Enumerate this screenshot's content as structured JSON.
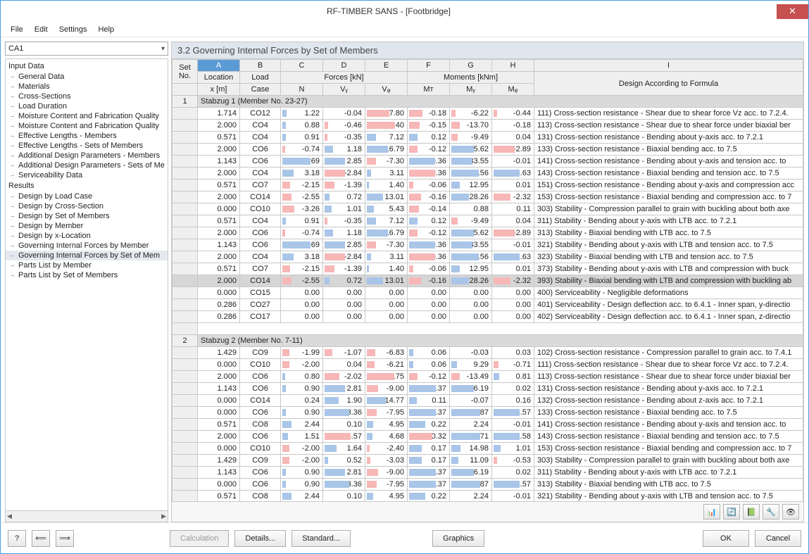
{
  "window": {
    "title": "RF-TIMBER SANS - [Footbridge]"
  },
  "menu": [
    "File",
    "Edit",
    "Settings",
    "Help"
  ],
  "sidebar": {
    "combo": "CA1",
    "groups": [
      {
        "title": "Input Data",
        "items": [
          "General Data",
          "Materials",
          "Cross-Sections",
          "Load Duration",
          "Moisture Content and Fabrication Quality",
          "Moisture Content and Fabrication Quality",
          "Effective Lengths - Members",
          "Effective Lengths - Sets of Members",
          "Additional Design Parameters - Members",
          "Additional Design Parameters - Sets of Me",
          "Serviceability Data"
        ]
      },
      {
        "title": "Results",
        "items": [
          "Design by Load Case",
          "Design by Cross-Section",
          "Design by Set of Members",
          "Design by Member",
          "Design by x-Location",
          "Governing Internal Forces by Member",
          "Governing Internal Forces by Set of Mem",
          "Parts List by Member",
          "Parts List by Set of Members"
        ],
        "selected": 6
      }
    ]
  },
  "panel": {
    "title": "3.2  Governing Internal Forces by Set of Members",
    "letters": [
      "A",
      "B",
      "C",
      "D",
      "E",
      "F",
      "G",
      "H",
      "I"
    ],
    "group_forces": "Forces [kN]",
    "group_moments": "Moments [kNm]",
    "head": {
      "set": "Set",
      "no": "No.",
      "loc": "Location",
      "x": "x [m]",
      "lc1": "Load",
      "lc2": "Case",
      "N": "N",
      "Vy": "Vᵧ",
      "Vz": "Vᵩ",
      "MT": "Mᴛ",
      "My": "Mᵧ",
      "Mz": "Mᵩ",
      "design": "Design According to Formula"
    },
    "sets": [
      {
        "no": "1",
        "label": "Stabzug 1 (Member No. 23-27)",
        "rows": [
          {
            "x": "1.714",
            "lc": "CO12",
            "N": "1.22",
            "Vy": "-0.04",
            "Vz": "-17.80",
            "MT": "-0.18",
            "My": "-6.22",
            "Mz": "-0.44",
            "d": "111) Cross-section resistance - Shear due to shear force Vz acc. to 7.2.4."
          },
          {
            "x": "2.000",
            "lc": "CO4",
            "N": "0.88",
            "Vy": "-0.46",
            "Vz": "-22.40",
            "MT": "-0.15",
            "My": "-13.70",
            "Mz": "-0.18",
            "d": "113) Cross-section resistance - Shear due to shear force under biaxial ber"
          },
          {
            "x": "0.571",
            "lc": "CO4",
            "N": "0.91",
            "Vy": "-0.35",
            "Vz": "7.12",
            "MT": "0.12",
            "My": "-9.49",
            "Mz": "0.04",
            "d": "131) Cross-section resistance - Bending about y-axis acc. to 7.2.1"
          },
          {
            "x": "2.000",
            "lc": "CO6",
            "N": "-0.74",
            "Vy": "1.18",
            "Vz": "16.79",
            "MT": "-0.12",
            "My": "35.62",
            "Mz": "-2.89",
            "d": "133) Cross-section resistance - Biaxial bending acc. to 7.5"
          },
          {
            "x": "1.143",
            "lc": "CO6",
            "N": "7.69",
            "Vy": "2.85",
            "Vz": "-7.30",
            "MT": "0.36",
            "My": "33.55",
            "Mz": "-0.01",
            "d": "141) Cross-section resistance - Bending about y-axis and tension acc. to "
          },
          {
            "x": "2.000",
            "lc": "CO4",
            "N": "3.18",
            "Vy": "-2.84",
            "Vz": "3.11",
            "MT": "-0.36",
            "My": "43.56",
            "Mz": "3.63",
            "d": "143) Cross-section resistance - Biaxial bending and tension acc. to 7.5"
          },
          {
            "x": "0.571",
            "lc": "CO7",
            "N": "-2.15",
            "Vy": "-1.39",
            "Vz": "1.40",
            "MT": "-0.06",
            "My": "12.95",
            "Mz": "0.01",
            "d": "151) Cross-section resistance - Bending about y-axis and compression acc"
          },
          {
            "x": "2.000",
            "lc": "CO14",
            "N": "-2.55",
            "Vy": "0.72",
            "Vz": "13.01",
            "MT": "-0.16",
            "My": "28.26",
            "Mz": "-2.32",
            "d": "153) Cross-section resistance - Biaxial bending and compression acc. to 7"
          },
          {
            "x": "0.000",
            "lc": "CO10",
            "N": "-3.26",
            "Vy": "1.01",
            "Vz": "5.43",
            "MT": "-0.14",
            "My": "0.88",
            "Mz": "0.11",
            "d": "303) Stability - Compression parallel to grain with buckling about both axe"
          },
          {
            "x": "0.571",
            "lc": "CO4",
            "N": "0.91",
            "Vy": "-0.35",
            "Vz": "7.12",
            "MT": "0.12",
            "My": "-9.49",
            "Mz": "0.04",
            "d": "311) Stability - Bending about y-axis with LTB acc. to 7.2.1"
          },
          {
            "x": "2.000",
            "lc": "CO6",
            "N": "-0.74",
            "Vy": "1.18",
            "Vz": "16.79",
            "MT": "-0.12",
            "My": "35.62",
            "Mz": "-2.89",
            "d": "313) Stability - Biaxial bending with LTB acc. to 7.5"
          },
          {
            "x": "1.143",
            "lc": "CO6",
            "N": "7.69",
            "Vy": "2.85",
            "Vz": "-7.30",
            "MT": "0.36",
            "My": "33.55",
            "Mz": "-0.01",
            "d": "321) Stability - Bending about y-axis with LTB and tension acc. to 7.5"
          },
          {
            "x": "2.000",
            "lc": "CO4",
            "N": "3.18",
            "Vy": "-2.84",
            "Vz": "3.11",
            "MT": "-0.36",
            "My": "43.56",
            "Mz": "3.63",
            "d": "323) Stability - Biaxial bending with LTB and tension acc. to 7.5"
          },
          {
            "x": "0.571",
            "lc": "CO7",
            "N": "-2.15",
            "Vy": "-1.39",
            "Vz": "1.40",
            "MT": "-0.06",
            "My": "12.95",
            "Mz": "0.01",
            "d": "373) Stability - Bending about y-axis with LTB and compression with buck"
          },
          {
            "x": "2.000",
            "lc": "CO14",
            "N": "-2.55",
            "Vy": "0.72",
            "Vz": "13.01",
            "MT": "-0.16",
            "My": "28.26",
            "Mz": "-2.32",
            "d": "393) Stability - Biaxial bending with LTB and compression with buckling ab",
            "sel": true
          },
          {
            "x": "0.000",
            "lc": "CO15",
            "N": "0.00",
            "Vy": "0.00",
            "Vz": "0.00",
            "MT": "0.00",
            "My": "0.00",
            "Mz": "0.00",
            "d": "400) Serviceability - Negligible deformations"
          },
          {
            "x": "0.286",
            "lc": "CO27",
            "N": "0.00",
            "Vy": "0.00",
            "Vz": "0.00",
            "MT": "0.00",
            "My": "0.00",
            "Mz": "0.00",
            "d": "401) Serviceability - Design deflection acc. to 6.4.1 - Inner span, y-directio"
          },
          {
            "x": "0.286",
            "lc": "CO17",
            "N": "0.00",
            "Vy": "0.00",
            "Vz": "0.00",
            "MT": "0.00",
            "My": "0.00",
            "Mz": "0.00",
            "d": "402) Serviceability - Design deflection acc. to 6.4.1 - Inner span, z-directio"
          }
        ]
      },
      {
        "no": "2",
        "label": "Stabzug 2 (Member No. 7-11)",
        "rows": [
          {
            "x": "1.429",
            "lc": "CO9",
            "N": "-1.99",
            "Vy": "-1.07",
            "Vz": "-6.83",
            "MT": "0.06",
            "My": "-0.03",
            "Mz": "0.03",
            "d": "102) Cross-section resistance - Compression parallel to grain acc. to 7.4.1"
          },
          {
            "x": "0.000",
            "lc": "CO10",
            "N": "-2.00",
            "Vy": "0.04",
            "Vz": "-6.21",
            "MT": "0.06",
            "My": "9.29",
            "Mz": "-0.71",
            "d": "111) Cross-section resistance - Shear due to shear force Vz acc. to 7.2.4."
          },
          {
            "x": "2.000",
            "lc": "CO6",
            "N": "0.80",
            "Vy": "-2.02",
            "Vz": "-21.75",
            "MT": "-0.12",
            "My": "-13.49",
            "Mz": "0.81",
            "d": "113) Cross-section resistance - Shear due to shear force under biaxial ber"
          },
          {
            "x": "1.143",
            "lc": "CO6",
            "N": "0.90",
            "Vy": "2.81",
            "Vz": "-9.00",
            "MT": "0.37",
            "My": "36.19",
            "Mz": "0.02",
            "d": "131) Cross-section resistance - Bending about y-axis acc. to 7.2.1"
          },
          {
            "x": "0.000",
            "lc": "CO14",
            "N": "0.24",
            "Vy": "1.90",
            "Vz": "14.77",
            "MT": "0.11",
            "My": "-0.07",
            "Mz": "0.16",
            "d": "132) Cross-section resistance - Bending about z-axis acc. to 7.2.1"
          },
          {
            "x": "0.000",
            "lc": "CO6",
            "N": "0.90",
            "Vy": "3.36",
            "Vz": "-7.95",
            "MT": "0.37",
            "My": "45.87",
            "Mz": "3.57",
            "d": "133) Cross-section resistance - Biaxial bending acc. to 7.5"
          },
          {
            "x": "0.571",
            "lc": "CO8",
            "N": "2.44",
            "Vy": "0.10",
            "Vz": "4.95",
            "MT": "0.22",
            "My": "2.24",
            "Mz": "-0.01",
            "d": "141) Cross-section resistance - Bending about y-axis and tension acc. to "
          },
          {
            "x": "2.000",
            "lc": "CO6",
            "N": "1.51",
            "Vy": "-3.57",
            "Vz": "4.68",
            "MT": "-0.32",
            "My": "45.71",
            "Mz": "3.58",
            "d": "143) Cross-section resistance - Biaxial bending and tension acc. to 7.5"
          },
          {
            "x": "0.000",
            "lc": "CO10",
            "N": "-2.00",
            "Vy": "1.64",
            "Vz": "-2.40",
            "MT": "0.17",
            "My": "14.98",
            "Mz": "1.01",
            "d": "153) Cross-section resistance - Biaxial bending and compression acc. to 7"
          },
          {
            "x": "1.429",
            "lc": "CO9",
            "N": "-2.00",
            "Vy": "0.52",
            "Vz": "-3.03",
            "MT": "0.17",
            "My": "11.09",
            "Mz": "-0.53",
            "d": "303) Stability - Compression parallel to grain with buckling about both axe"
          },
          {
            "x": "1.143",
            "lc": "CO6",
            "N": "0.90",
            "Vy": "2.81",
            "Vz": "-9.00",
            "MT": "0.37",
            "My": "36.19",
            "Mz": "0.02",
            "d": "311) Stability - Bending about y-axis with LTB acc. to 7.2.1"
          },
          {
            "x": "0.000",
            "lc": "CO6",
            "N": "0.90",
            "Vy": "3.36",
            "Vz": "-7.95",
            "MT": "0.37",
            "My": "45.87",
            "Mz": "3.57",
            "d": "313) Stability - Biaxial bending with LTB acc. to 7.5"
          },
          {
            "x": "0.571",
            "lc": "CO8",
            "N": "2.44",
            "Vy": "0.10",
            "Vz": "4.95",
            "MT": "0.22",
            "My": "2.24",
            "Mz": "-0.01",
            "d": "321) Stability - Bending about y-axis with LTB and tension acc. to 7.5"
          }
        ]
      }
    ]
  },
  "footer": {
    "calc": "Calculation",
    "details": "Details...",
    "standard": "Standard...",
    "graphics": "Graphics",
    "ok": "OK",
    "cancel": "Cancel"
  },
  "iconbtns": [
    "📊",
    "🔄",
    "📗",
    "🔧",
    "👁"
  ]
}
